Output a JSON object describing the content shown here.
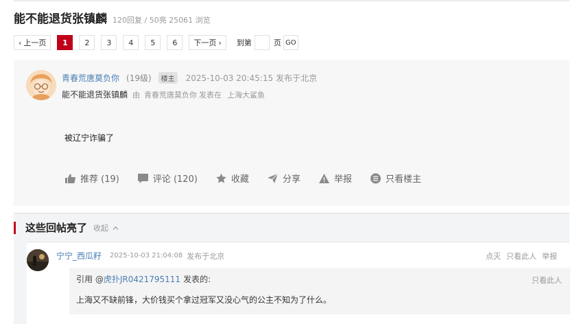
{
  "thread": {
    "title": "能不能退货张镇麟",
    "meta": "120回复 / 50亮 25061 浏览"
  },
  "pager": {
    "prev_label": "上一页",
    "pages": [
      "1",
      "2",
      "3",
      "4",
      "5",
      "6"
    ],
    "next_label": "下一页",
    "goto_label": "到第",
    "page_suffix": "页",
    "go_label": "GO"
  },
  "post": {
    "author": "青春荒唐莫负你",
    "level": "(19级)",
    "badge": "楼主",
    "time": "2025-10-03 20:45:15",
    "location": "发布于北京",
    "sub_title": "能不能退货张镇麟",
    "sub_by": "由",
    "sub_author": "青春荒唐莫负你",
    "sub_in": "发表在",
    "sub_board": "上海大鲨鱼",
    "content": "被辽宁诈骗了",
    "actions": {
      "recommend": "推荐 (19)",
      "comment": "评论 (120)",
      "favorite": "收藏",
      "share": "分享",
      "report": "举报",
      "only_op": "只看楼主"
    }
  },
  "hot": {
    "title": "这些回帖亮了",
    "toggle": "收起"
  },
  "reply": {
    "author": "宁宁_西瓜籽",
    "time": "2025-10-03 21:04:08",
    "location": "发布于北京",
    "actions": [
      "点灭",
      "只看此人",
      "举报"
    ],
    "quote": {
      "prefix": "引用 @",
      "user": "虎扑JR0421795111",
      "said": "发表的:",
      "only": "只看此人",
      "text": "上海又不缺前锋，大价钱买个拿过冠军又没心气的公主不知为了什么。"
    }
  },
  "colors": {
    "accent": "#c0001a",
    "link": "#4a7fb5"
  }
}
